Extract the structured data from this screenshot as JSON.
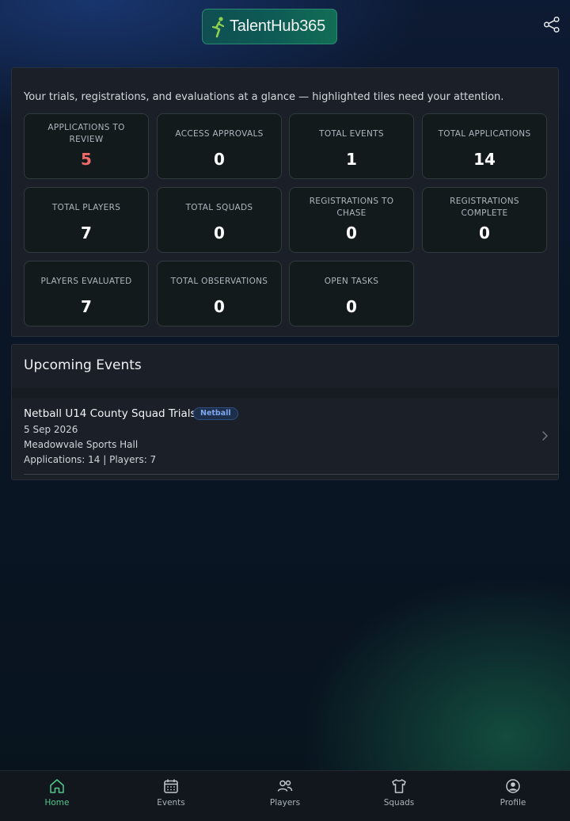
{
  "header": {
    "logo_text": "TalentHub365",
    "share_icon": "share-icon"
  },
  "dashboard": {
    "intro": "Your trials, registrations, and evaluations at a glance — highlighted tiles need your attention.",
    "tiles": [
      {
        "label": "APPLICATIONS TO REVIEW",
        "value": "5"
      },
      {
        "label": "ACCESS APPROVALS",
        "value": "0"
      },
      {
        "label": "TOTAL EVENTS",
        "value": "1"
      },
      {
        "label": "TOTAL APPLICATIONS",
        "value": "14"
      },
      {
        "label": "TOTAL PLAYERS",
        "value": "7"
      },
      {
        "label": "TOTAL SQUADS",
        "value": "0"
      },
      {
        "label": "REGISTRATIONS TO CHASE",
        "value": "0"
      },
      {
        "label": "REGISTRATIONS COMPLETE",
        "value": "0"
      },
      {
        "label": "PLAYERS EVALUATED",
        "value": "7"
      },
      {
        "label": "TOTAL OBSERVATIONS",
        "value": "0"
      },
      {
        "label": "OPEN TASKS",
        "value": "0"
      }
    ],
    "alert_color": "#f06a6a"
  },
  "events": {
    "title": "Upcoming Events",
    "items": [
      {
        "name": "Netball U14 County Squad Trials",
        "badge": "Netball",
        "date": "5 Sep 2026",
        "venue": "Meadowvale Sports Hall",
        "stats": "Applications: 14 | Players: 7"
      }
    ]
  },
  "nav": {
    "active_color": "#53c98a",
    "items": [
      {
        "label": "Home",
        "icon": "home-icon"
      },
      {
        "label": "Events",
        "icon": "calendar-icon"
      },
      {
        "label": "Players",
        "icon": "players-icon"
      },
      {
        "label": "Squads",
        "icon": "shirt-icon"
      },
      {
        "label": "Profile",
        "icon": "profile-icon"
      }
    ]
  }
}
